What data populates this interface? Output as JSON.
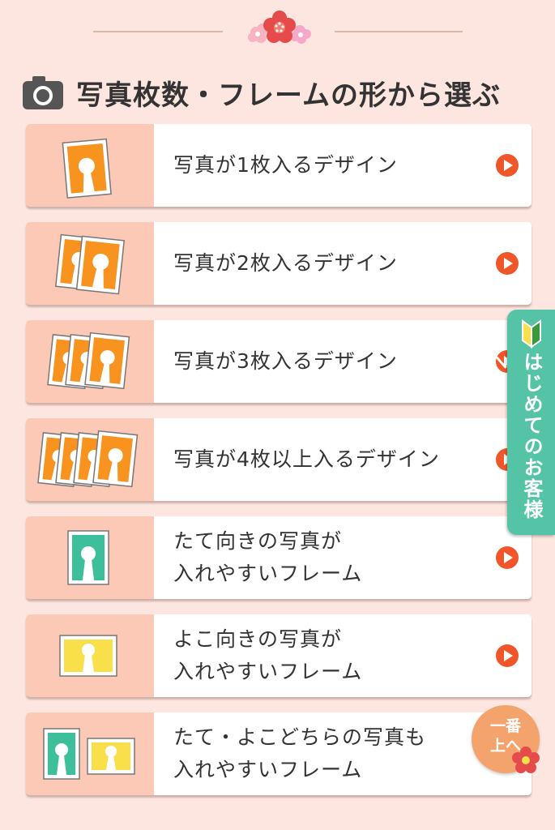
{
  "section": {
    "title": "写真枚数・フレームの形から選ぶ",
    "icon": "camera-icon"
  },
  "items": [
    {
      "label_lines": [
        "写真が1枚入るデザイン"
      ],
      "icon": "one-photo-frame-icon"
    },
    {
      "label_lines": [
        "写真が2枚入るデザイン"
      ],
      "icon": "two-photo-frames-icon"
    },
    {
      "label_lines": [
        "写真が3枚入るデザイン"
      ],
      "icon": "three-photo-frames-icon"
    },
    {
      "label_lines": [
        "写真が4枚以上入るデザイン"
      ],
      "icon": "four-photo-frames-icon"
    },
    {
      "label_lines": [
        "たて向きの写真が",
        "入れやすいフレーム"
      ],
      "icon": "portrait-frame-icon"
    },
    {
      "label_lines": [
        "よこ向きの写真が",
        "入れやすいフレーム"
      ],
      "icon": "landscape-frame-icon"
    },
    {
      "label_lines": [
        "たて・よこどちらの写真も",
        "入れやすいフレーム"
      ],
      "icon": "portrait-and-landscape-frames-icon"
    }
  ],
  "side_tab": {
    "label": "はじめてのお客様へ",
    "icon": "beginner-leaf-icon"
  },
  "top_button": {
    "line1": "一番",
    "line2": "上へ",
    "icon": "plum-flower-icon"
  },
  "colors": {
    "background": "#fde6e0",
    "thumb_bg": "#fbc9b6",
    "orange": "#f7931e",
    "teal": "#3dbf9c",
    "yellow": "#f9e04b",
    "arrow": "#f0562a",
    "side_tab": "#55c3a6",
    "top_button": "#f4a36c"
  }
}
